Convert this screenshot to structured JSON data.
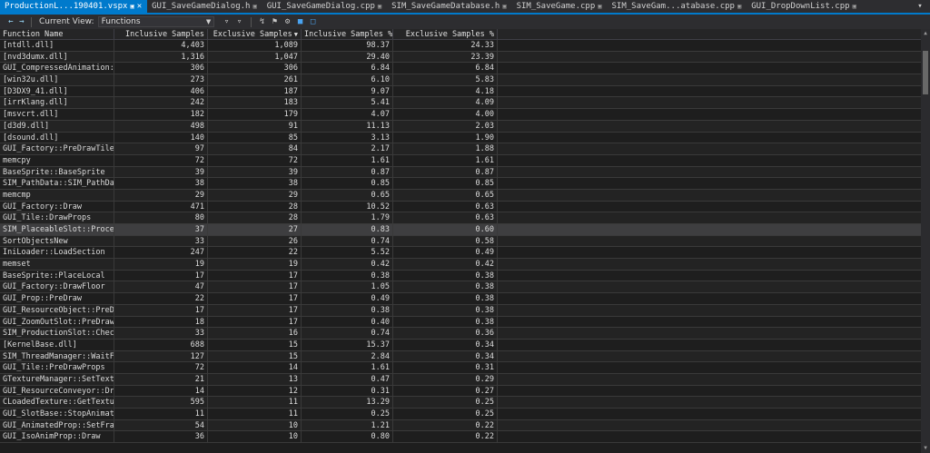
{
  "tabs": [
    {
      "label": "ProductionL...190401.vspx",
      "active": true
    },
    {
      "label": "GUI_SaveGameDialog.h",
      "active": false
    },
    {
      "label": "GUI_SaveGameDialog.cpp",
      "active": false
    },
    {
      "label": "SIM_SaveGameDatabase.h",
      "active": false
    },
    {
      "label": "SIM_SaveGame.cpp",
      "active": false
    },
    {
      "label": "SIM_SaveGam...atabase.cpp",
      "active": false
    },
    {
      "label": "GUI_DropDownList.cpp",
      "active": false
    }
  ],
  "toolbar": {
    "current_view_label": "Current View:",
    "current_view_value": "Functions"
  },
  "columns": [
    {
      "label": "Function Name",
      "align": "left"
    },
    {
      "label": "Inclusive Samples",
      "align": "right"
    },
    {
      "label": "Exclusive Samples",
      "align": "right",
      "sorted": "desc"
    },
    {
      "label": "Inclusive Samples %",
      "align": "right"
    },
    {
      "label": "Exclusive Samples %",
      "align": "right"
    }
  ],
  "rows": [
    [
      "[ntdll.dll]",
      "4,403",
      "1,089",
      "98.37",
      "24.33"
    ],
    [
      "[nvd3dumx.dll]",
      "1,316",
      "1,047",
      "29.40",
      "23.39"
    ],
    [
      "GUI_CompressedAnimation:",
      "306",
      "306",
      "6.84",
      "6.84"
    ],
    [
      "[win32u.dll]",
      "273",
      "261",
      "6.10",
      "5.83"
    ],
    [
      "[D3DX9_41.dll]",
      "406",
      "187",
      "9.07",
      "4.18"
    ],
    [
      "[irrKlang.dll]",
      "242",
      "183",
      "5.41",
      "4.09"
    ],
    [
      "[msvcrt.dll]",
      "182",
      "179",
      "4.07",
      "4.00"
    ],
    [
      "[d3d9.dll]",
      "498",
      "91",
      "11.13",
      "2.03"
    ],
    [
      "[dsound.dll]",
      "140",
      "85",
      "3.13",
      "1.90"
    ],
    [
      "GUI_Factory::PreDrawTile",
      "97",
      "84",
      "2.17",
      "1.88"
    ],
    [
      "memcpy",
      "72",
      "72",
      "1.61",
      "1.61"
    ],
    [
      "BaseSprite::BaseSprite",
      "39",
      "39",
      "0.87",
      "0.87"
    ],
    [
      "SIM_PathData::SIM_PathDa",
      "38",
      "38",
      "0.85",
      "0.85"
    ],
    [
      "memcmp",
      "29",
      "29",
      "0.65",
      "0.65"
    ],
    [
      "GUI_Factory::Draw",
      "471",
      "28",
      "10.52",
      "0.63"
    ],
    [
      "GUI_Tile::DrawProps",
      "80",
      "28",
      "1.79",
      "0.63"
    ],
    [
      "SIM_PlaceableSlot::Proce",
      "37",
      "27",
      "0.83",
      "0.60"
    ],
    [
      "SortObjectsNew",
      "33",
      "26",
      "0.74",
      "0.58"
    ],
    [
      "IniLoader::LoadSection",
      "247",
      "22",
      "5.52",
      "0.49"
    ],
    [
      "memset",
      "19",
      "19",
      "0.42",
      "0.42"
    ],
    [
      "BaseSprite::PlaceLocal",
      "17",
      "17",
      "0.38",
      "0.38"
    ],
    [
      "GUI_Factory::DrawFloor",
      "47",
      "17",
      "1.05",
      "0.38"
    ],
    [
      "GUI_Prop::PreDraw",
      "22",
      "17",
      "0.49",
      "0.38"
    ],
    [
      "GUI_ResourceObject::PreD",
      "17",
      "17",
      "0.38",
      "0.38"
    ],
    [
      "GUI_ZoomOutSlot::PreDraw",
      "18",
      "17",
      "0.40",
      "0.38"
    ],
    [
      "SIM_ProductionSlot::Chec",
      "33",
      "16",
      "0.74",
      "0.36"
    ],
    [
      "[KernelBase.dll]",
      "688",
      "15",
      "15.37",
      "0.34"
    ],
    [
      "SIM_ThreadManager::WaitF",
      "127",
      "15",
      "2.84",
      "0.34"
    ],
    [
      "GUI_Tile::PreDrawProps",
      "72",
      "14",
      "1.61",
      "0.31"
    ],
    [
      "GTextureManager::SetText",
      "21",
      "13",
      "0.47",
      "0.29"
    ],
    [
      "GUI_ResourceConveyor::Dr",
      "14",
      "12",
      "0.31",
      "0.27"
    ],
    [
      "CLoadedTexture::GetTextu",
      "595",
      "11",
      "13.29",
      "0.25"
    ],
    [
      "GUI_SlotBase::StopAnimat",
      "11",
      "11",
      "0.25",
      "0.25"
    ],
    [
      "GUI_AnimatedProp::SetFra",
      "54",
      "10",
      "1.21",
      "0.22"
    ],
    [
      "GUI_IsoAnimProp::Draw",
      "36",
      "10",
      "0.80",
      "0.22"
    ]
  ],
  "highlighted_row": 16
}
